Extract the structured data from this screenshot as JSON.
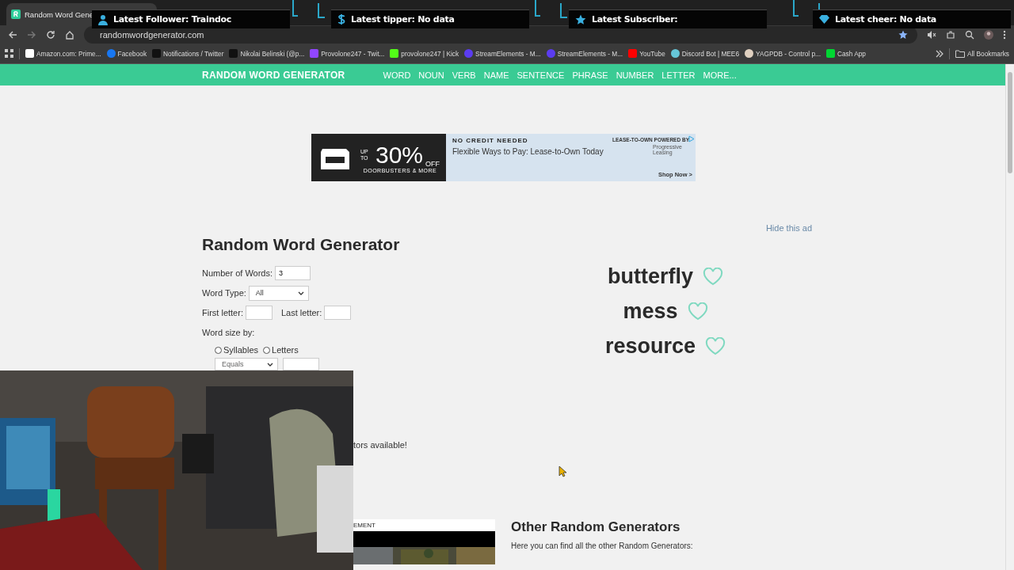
{
  "browser": {
    "tab": {
      "title": "Random Word Gene",
      "selected": true
    },
    "url": "randomwordgenerator.com",
    "bookmarks": [
      {
        "label": "Amazon.com: Prime...",
        "kind": "amazon"
      },
      {
        "label": "Facebook",
        "kind": "facebook"
      },
      {
        "label": "Notifications / Twitter",
        "kind": "x"
      },
      {
        "label": "Nikolai Belinski (@p...",
        "kind": "tiktok"
      },
      {
        "label": "Provolone247 - Twit...",
        "kind": "twitch"
      },
      {
        "label": "provolone247 | Kick",
        "kind": "kick"
      },
      {
        "label": "StreamElements - M...",
        "kind": "streamelements"
      },
      {
        "label": "StreamElements - M...",
        "kind": "streamelements"
      },
      {
        "label": "YouTube",
        "kind": "youtube"
      },
      {
        "label": "Discord Bot | MEE6",
        "kind": "discord"
      },
      {
        "label": "YAGPDB - Control p...",
        "kind": "yagpdb"
      },
      {
        "label": "Cash App",
        "kind": "cashapp"
      }
    ],
    "all_bookmarks": "All Bookmarks"
  },
  "site": {
    "brand": "RANDOM WORD GENERATOR",
    "nav": [
      "WORD",
      "NOUN",
      "VERB",
      "NAME",
      "SENTENCE",
      "PHRASE",
      "NUMBER",
      "LETTER",
      "MORE..."
    ]
  },
  "ad": {
    "up_to": "UP TO",
    "percent": "30%",
    "off": "OFF",
    "deal": "DOORBUSTERS & MORE",
    "headline": "NO CREDIT NEEDED",
    "title": "Flexible Ways to Pay: Lease-to-Own Today",
    "powered_by": "LEASE-TO-OWN POWERED BY",
    "brand": "Progressive Leasing",
    "cta": "Shop Now >"
  },
  "hide_ad": "Hide this ad",
  "title": "Random Word Generator",
  "form": {
    "number_label": "Number of Words:",
    "number_value": "3",
    "type_label": "Word Type:",
    "type_value": "All",
    "first_label": "First letter:",
    "last_label": "Last letter:",
    "size_label": "Word size by:",
    "size_options": [
      {
        "label": "Syllables",
        "selected": false
      },
      {
        "label": "Letters",
        "selected": false
      }
    ],
    "compare_value": "Equals"
  },
  "words": [
    "butterfly",
    "mess",
    "resource"
  ],
  "partial_text": "tors available!",
  "ad_label": "EMENT",
  "other": {
    "title": "Other Random Generators",
    "intro": "Here you can find all the other Random Generators:"
  },
  "overlay": {
    "alerts": [
      {
        "kind": "follower",
        "text": "Latest Follower: Traindoc"
      },
      {
        "kind": "tipper",
        "text": "Latest tipper: No data"
      },
      {
        "kind": "subscriber",
        "text": "Latest Subscriber:"
      },
      {
        "kind": "cheer",
        "text": "Latest cheer: No data"
      }
    ]
  }
}
